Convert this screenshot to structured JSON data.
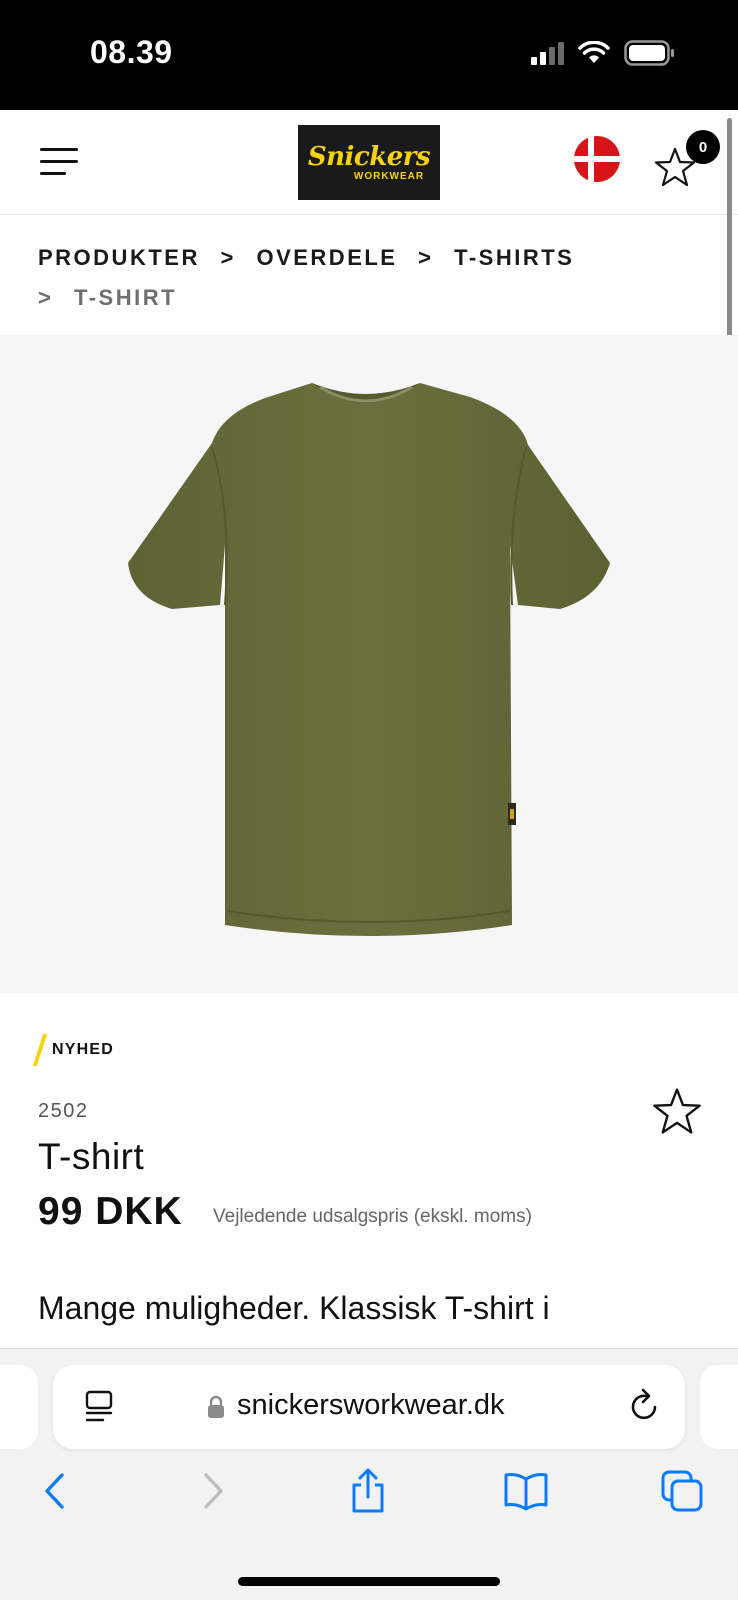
{
  "status_bar": {
    "time": "08.39"
  },
  "header": {
    "logo_main": "Snickers",
    "logo_sub": "WORKWEAR",
    "favorites_count": "0",
    "flag_colors": [
      "#d7141a",
      "#ffffff"
    ]
  },
  "breadcrumb": {
    "items": [
      "PRODUKTER",
      "OVERDELE",
      "T-SHIRTS",
      "T-SHIRT"
    ],
    "separator": ">"
  },
  "product": {
    "image_color": "#6b6e3c",
    "badge": "NYHED",
    "sku": "2502",
    "title": "T-shirt",
    "price": "99 DKK",
    "price_note": "Vejledende udsalgspris (ekskl. moms)",
    "description_start": "Mange muligheder. Klassisk T-shirt i"
  },
  "browser": {
    "url": "snickersworkwear.dk"
  },
  "colors": {
    "accent_yellow": "#f5d20e",
    "ios_blue": "#0a7aff"
  }
}
